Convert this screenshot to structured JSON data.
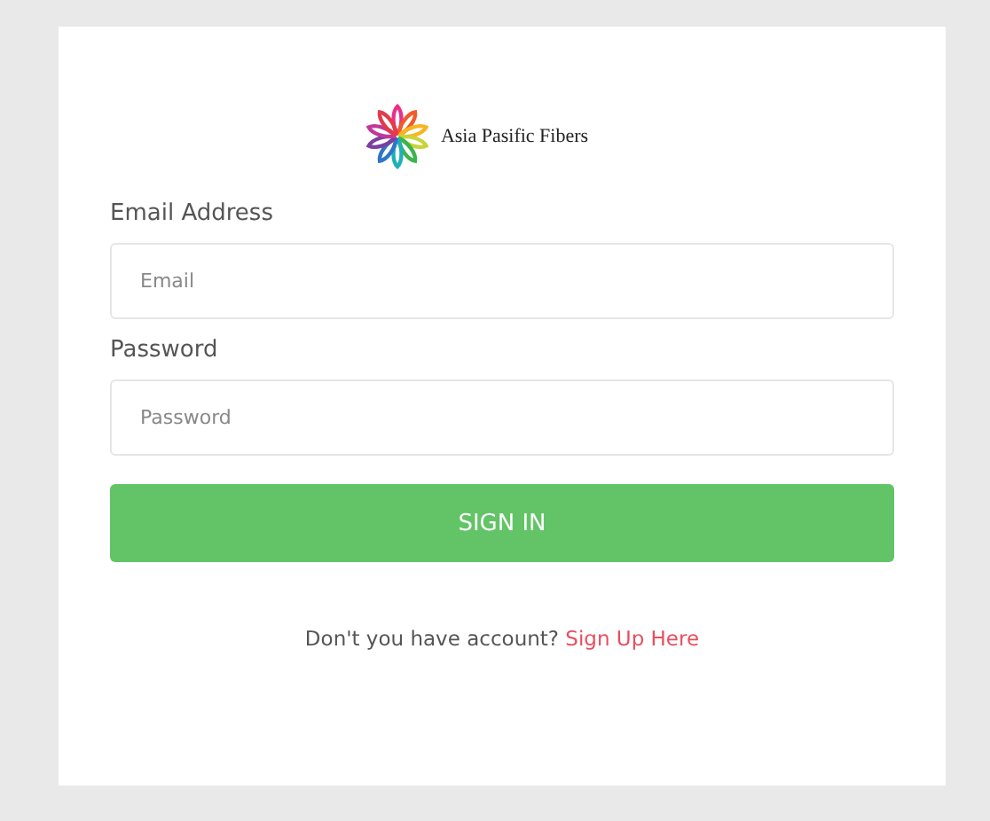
{
  "brand": {
    "name": "Asia Pasific Fibers"
  },
  "fields": [
    {
      "label": "Email Address",
      "placeholder": "Email"
    },
    {
      "label": "Password",
      "placeholder": "Password"
    }
  ],
  "submit": "SIGN IN",
  "footer": {
    "text": "Don't you have account?",
    "link": "Sign Up Here"
  }
}
